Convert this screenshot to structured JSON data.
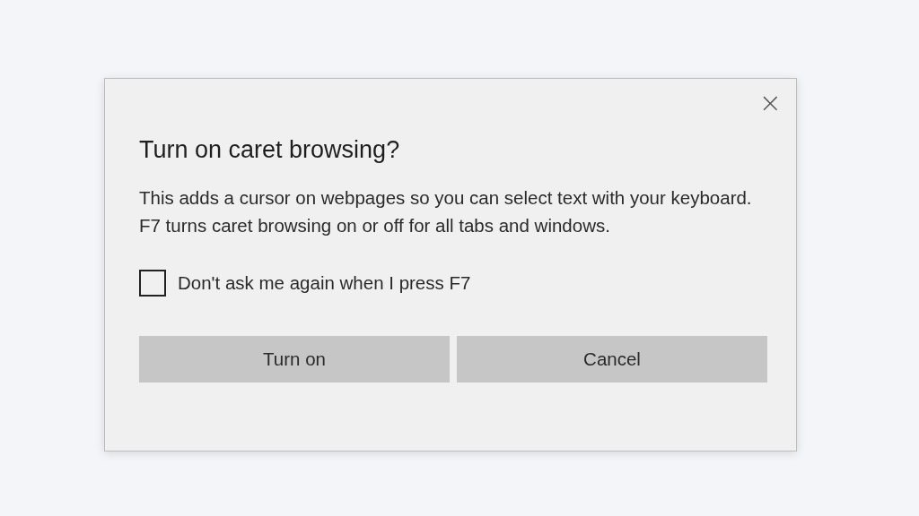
{
  "dialog": {
    "close_icon": "×",
    "title": "Turn on caret browsing?",
    "message": "This adds a cursor on webpages so you can select text with your keyboard. F7 turns caret browsing on or off for all tabs and windows.",
    "checkbox": {
      "label": "Don't ask me again when I press F7",
      "checked": false
    },
    "buttons": [
      "Turn on",
      "Cancel"
    ]
  }
}
